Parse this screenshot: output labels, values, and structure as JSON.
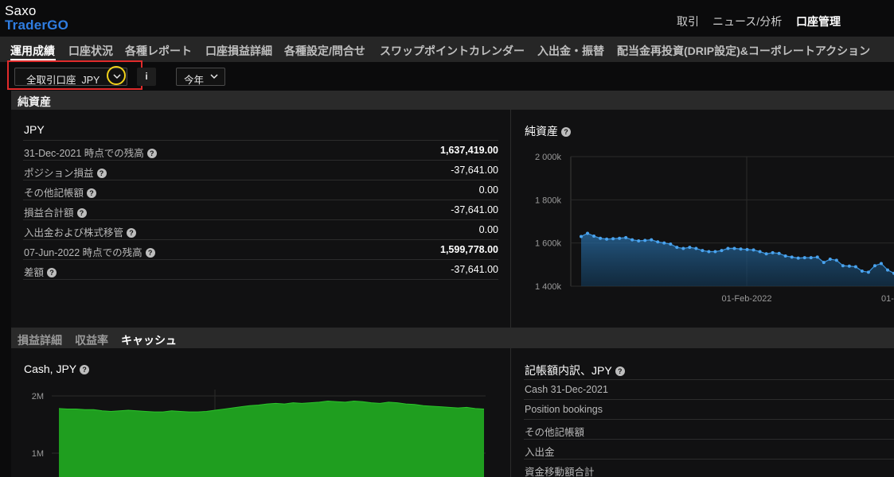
{
  "app": {
    "brand_top": "Saxo",
    "brand_bottom": "TraderGO"
  },
  "topnav": [
    "取引",
    "ニュース/分析",
    "口座管理"
  ],
  "subnav": [
    "運用成績",
    "口座状況",
    "各種レポート",
    "口座損益詳細",
    "各種設定/問合せ",
    "スワップポイントカレンダー",
    "入出金・振替",
    "配当金再投資(DRIP設定)&コーポレートアクション"
  ],
  "filters": {
    "account": "全取引口座",
    "currency": "JPY",
    "info": "i",
    "period": "今年"
  },
  "net_assets": {
    "section_title": "純資産",
    "currency": "JPY",
    "rows": [
      {
        "label": "31-Dec-2021 時点での残高",
        "value": "1,637,419.00",
        "bold": true
      },
      {
        "label": "ポジション損益",
        "value": "-37,641.00",
        "bold": false
      },
      {
        "label": "その他記帳額",
        "value": "0.00",
        "bold": false
      },
      {
        "label": "損益合計額",
        "value": "-37,641.00",
        "bold": false
      },
      {
        "label": "入出金および株式移管",
        "value": "0.00",
        "bold": false
      },
      {
        "label": "07-Jun-2022 時点での残高",
        "value": "1,599,778.00",
        "bold": true
      },
      {
        "label": "差額",
        "value": "-37,641.00",
        "bold": false
      }
    ],
    "chart_title": "純資産"
  },
  "cash": {
    "tabs": [
      "損益詳細",
      "収益率",
      "キャッシュ"
    ],
    "chart_title": "Cash, JPY",
    "breakdown_title": "記帳額内訳、JPY",
    "breakdown_rows": [
      "Cash 31-Dec-2021",
      "Position bookings",
      "その他記帳額",
      "入出金",
      "資金移動額合計"
    ]
  },
  "chart_data": [
    {
      "type": "area",
      "title": "純資産",
      "y_ticks": [
        "2 000k",
        "1 800k",
        "1 600k",
        "1 400k"
      ],
      "ylim": [
        1400000,
        2000000
      ],
      "x_tick_labels": [
        "01-Feb-2022",
        "01-"
      ],
      "grid": true,
      "color": "#3a8fd6",
      "series": [
        {
          "values": [
            1630000,
            1645000,
            1632000,
            1622000,
            1618000,
            1620000,
            1622000,
            1625000,
            1615000,
            1610000,
            1612000,
            1615000,
            1605000,
            1600000,
            1595000,
            1580000,
            1575000,
            1580000,
            1575000,
            1565000,
            1560000,
            1560000,
            1565000,
            1575000,
            1575000,
            1572000,
            1570000,
            1568000,
            1560000,
            1550000,
            1555000,
            1552000,
            1540000,
            1535000,
            1530000,
            1532000,
            1532000,
            1535000,
            1510000,
            1525000,
            1520000,
            1495000,
            1493000,
            1490000,
            1470000,
            1465000,
            1495000,
            1505000,
            1475000,
            1460000
          ]
        }
      ]
    },
    {
      "type": "area",
      "title": "Cash, JPY",
      "y_ticks": [
        "2M",
        "1M"
      ],
      "color": "#1f9e1f",
      "grid": true,
      "series": [
        {
          "values": [
            1.78,
            1.77,
            1.77,
            1.76,
            1.76,
            1.74,
            1.73,
            1.74,
            1.75,
            1.74,
            1.73,
            1.72,
            1.72,
            1.74,
            1.73,
            1.72,
            1.72,
            1.73,
            1.75,
            1.77,
            1.79,
            1.81,
            1.83,
            1.84,
            1.86,
            1.87,
            1.86,
            1.88,
            1.87,
            1.88,
            1.89,
            1.91,
            1.9,
            1.89,
            1.91,
            1.9,
            1.88,
            1.87,
            1.89,
            1.88,
            1.86,
            1.85,
            1.83,
            1.82,
            1.81,
            1.8,
            1.79,
            1.8,
            1.78,
            1.77
          ]
        }
      ]
    }
  ]
}
